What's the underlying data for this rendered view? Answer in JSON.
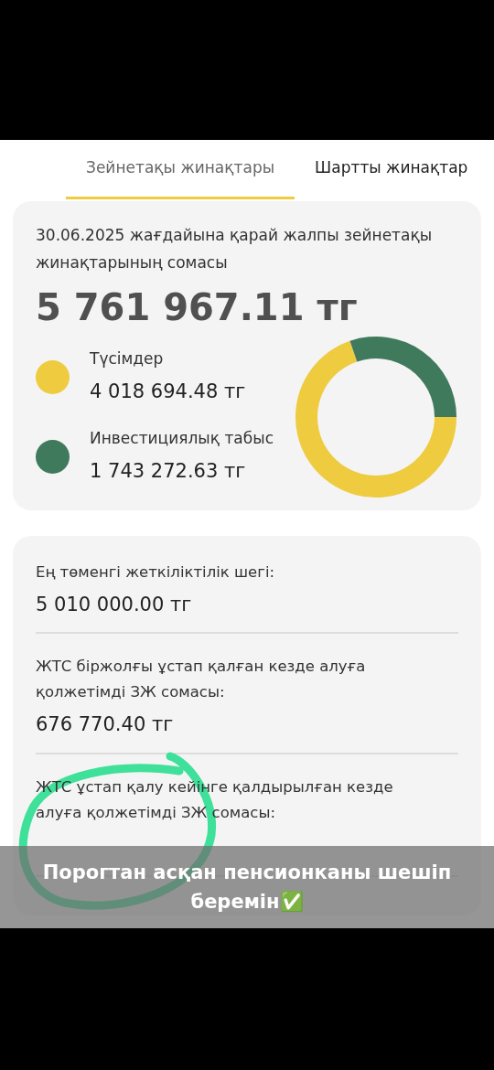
{
  "tabs": [
    {
      "label": "Зейнетақы жинақтары",
      "selected": true
    },
    {
      "label": "Шартты жинақтар",
      "selected": false
    }
  ],
  "summary": {
    "caption": "30.06.2025 жағдайына қарай жалпы зейнетақы жинақтарының сомасы",
    "total": "5 761 967.11 тг",
    "legend": [
      {
        "value": "4 018 694.48 тг",
        "color": "#eecb3f"
      },
      {
        "value": "1 743 272.63 тг",
        "color": "#3f7a5c"
      }
    ],
    "chart_data": {
      "type": "donut",
      "categories": [
        "Түсімдер",
        "Инвестициялық табыс"
      ],
      "values": [
        69.75,
        30.25
      ]
    }
  },
  "details": [
    {
      "label": "Ең төменгі жеткіліктілік шегі:",
      "value": "5 010 000.00 тг"
    },
    {
      "label": "ЖТС біржолғы ұстап қалған кезде алуға қолжетімді ЗЖ сомасы:",
      "value": "676 770.40 тг"
    },
    {
      "label": "ЖТС ұстап қалу кейінге қалдырылған кезде алуға қолжетімді ЗЖ сомасы:"
    }
  ],
  "caption_banner": {
    "text": "Порогтан асқан пенсионканы шешіп беремін✅"
  }
}
